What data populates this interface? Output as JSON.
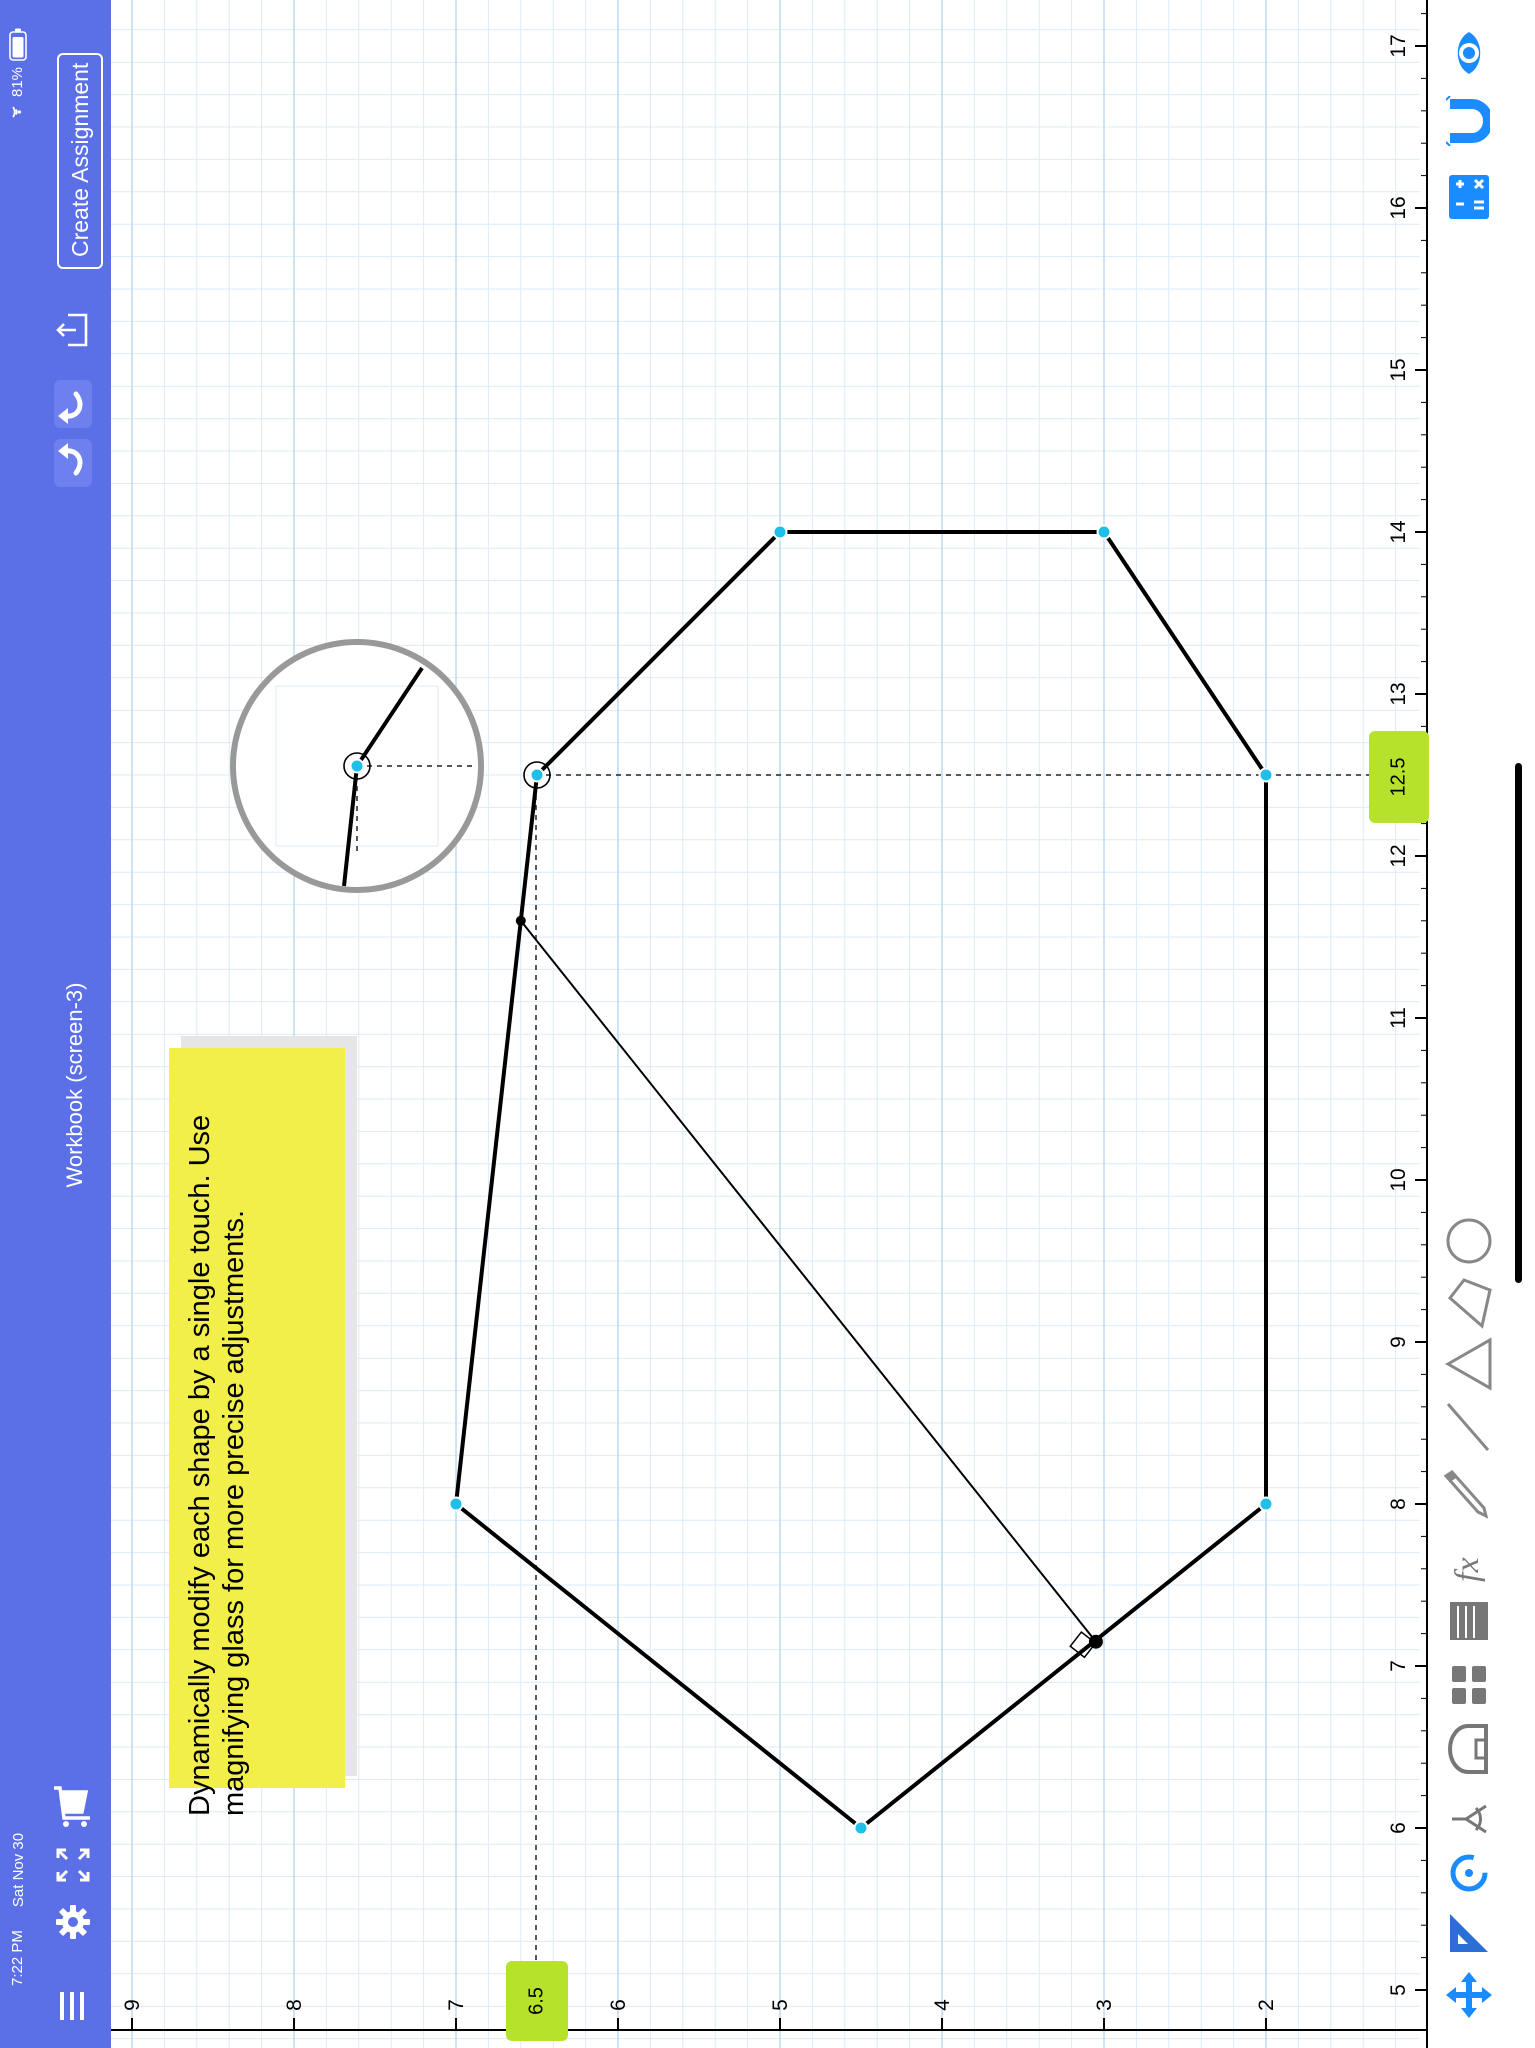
{
  "status_bar": {
    "time": "7:22 PM",
    "date": "Sat Nov 30",
    "battery": "81%"
  },
  "toolbar": {
    "title": "Workbook (screen-3)",
    "create_assignment_label": "Create Assignment"
  },
  "note": {
    "text": "Dynamically modify each shape by a single touch. Use magnifying glass for more precise adjustments."
  },
  "axis": {
    "x_ticks": [
      "5",
      "6",
      "7",
      "8",
      "9",
      "10",
      "11",
      "12",
      "13",
      "14",
      "15",
      "16",
      "17"
    ],
    "y_ticks": [
      "9",
      "8",
      "7",
      "6",
      "5",
      "4",
      "3",
      "2"
    ]
  },
  "measurements": {
    "x_value": "12.5",
    "y_value": "6.5"
  },
  "colors": {
    "toolbar_bg": "#5b6fe6",
    "note_bg": "#f2ef4a",
    "value_tag_bg": "#b6e22b",
    "vertex": "#1ec0ea",
    "grid_major": "#b9d9ef",
    "grid_minor": "#dcecf7",
    "tool_icon": "#1a8cff"
  },
  "tools": [
    "move-icon",
    "set-square-icon",
    "rotate-icon",
    "compass-icon",
    "protractor-icon",
    "counters-icon",
    "notes-icon",
    "function-icon",
    "pencil-icon",
    "line-icon",
    "triangle-icon",
    "quadrilateral-icon",
    "circle-icon",
    "calculator-icon",
    "magnet-icon",
    "eye-icon"
  ]
}
